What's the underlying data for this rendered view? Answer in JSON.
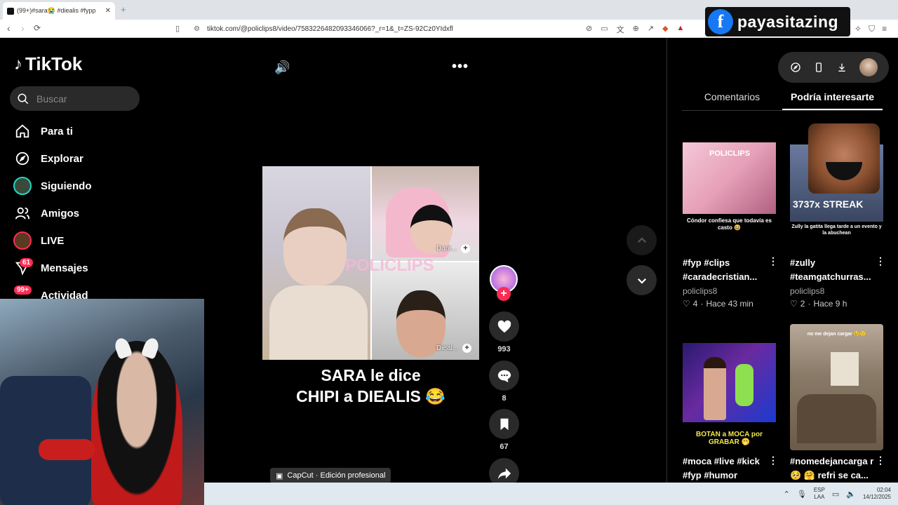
{
  "browser": {
    "tab_title": "(99+)#sara😭 #diealis #fypp",
    "url": "tiktok.com/@policlips8/video/7583226482093346066?_r=1&_t=ZS-92Cz0YIdxfl"
  },
  "overlay": {
    "facebook_name": "payasitazing",
    "facebook_letter": "f"
  },
  "sidebar": {
    "logo": "TikTok",
    "search_placeholder": "Buscar",
    "items": [
      {
        "label": "Para ti"
      },
      {
        "label": "Explorar"
      },
      {
        "label": "Siguiendo"
      },
      {
        "label": "Amigos"
      },
      {
        "label": "LIVE"
      },
      {
        "label": "Mensajes",
        "badge": "61"
      },
      {
        "label": "Actividad",
        "badge": "99+"
      }
    ]
  },
  "video": {
    "caption_line1": "SARA le dice",
    "caption_line2": "CHIPI a DIEALIS 😂",
    "tag_top": "Dani...",
    "tag_bottom": "Dieal...",
    "watermark": "POLICLIPS",
    "capcut": "CapCut · Edición profesional",
    "more": "•••"
  },
  "actions": {
    "likes": "993",
    "comments": "8",
    "saves": "67"
  },
  "panel": {
    "tab_comments": "Comentarios",
    "tab_suggestions": "Podría interesarte",
    "cards": [
      {
        "title": "#fyp #clips #caradecristian...",
        "author": "policlips8",
        "likes": "4",
        "time": "Hace 43 min",
        "thumb_caption": "Cóndor confiesa que todavía es casto 😆",
        "thumb_label": "POLICLIPS"
      },
      {
        "title": "#zully #teamgatchurras...",
        "author": "policlips8",
        "likes": "2",
        "time": "Hace 9 h",
        "thumb_caption": "Zully la gatita llega tarde a un evento y la abuchean",
        "thumb_label": "3737x STREAK"
      },
      {
        "title": "#moca #live #kick #fyp #humor",
        "thumb_caption": "BOTAN a MOCA por GRABAR 🫢"
      },
      {
        "title": "#nomedejancarga r🥺 🤗 refri se ca...",
        "thumb_caption": "no me dejan cargar 😢🙂"
      }
    ]
  },
  "taskbar": {
    "lang_line1": "ESP",
    "lang_line2": "LAA",
    "time": "02:04",
    "date": "14/12/2025"
  },
  "colors": {
    "accent": "#fe2c55",
    "facebook": "#1877f2"
  }
}
